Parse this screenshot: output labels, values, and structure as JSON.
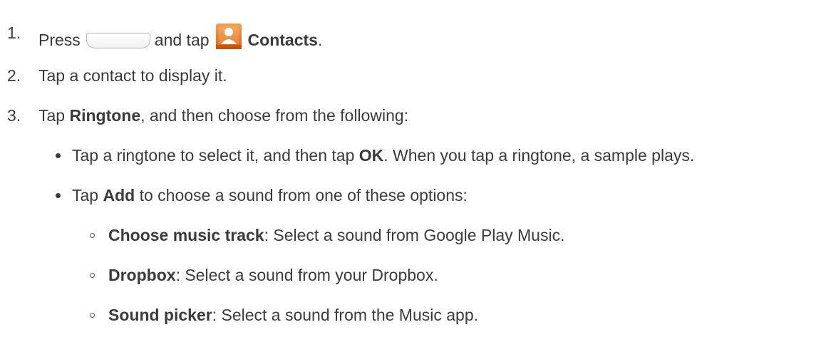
{
  "steps": [
    {
      "number": "1.",
      "press": "Press",
      "and_tap": "and tap",
      "contacts": "Contacts",
      "end": ".",
      "icons": [
        "home-key-icon",
        "contacts-app-icon"
      ]
    },
    {
      "number": "2.",
      "text": "Tap a contact to display it."
    },
    {
      "number": "3.",
      "tap": "Tap",
      "ringtone": "Ringtone",
      "rest": ", and then choose from the following:"
    }
  ],
  "bullets": [
    {
      "tap": "Tap a ringtone to select it, and then tap",
      "ok": "OK",
      "rest": ". When you tap a ringtone, a sample plays."
    },
    {
      "tap": "Tap",
      "add": "Add",
      "rest": "to choose a sound from one of these options:"
    }
  ],
  "options": [
    {
      "name": "Choose music track",
      "desc": ": Select a sound from Google Play Music."
    },
    {
      "name": "Dropbox",
      "desc": ": Select a sound from your Dropbox."
    },
    {
      "name": "Sound picker",
      "desc": ": Select a sound from the Music app."
    }
  ],
  "colors": {
    "text": "#3b3b3b",
    "contacts_icon_orange": "#f07a1c"
  }
}
